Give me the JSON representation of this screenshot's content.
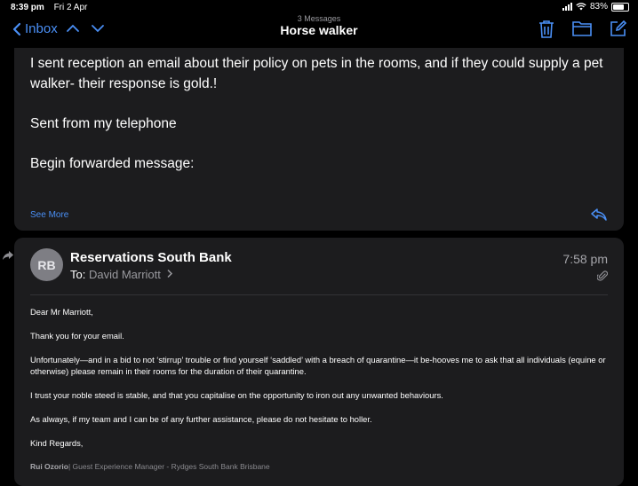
{
  "status": {
    "time": "8:39 pm",
    "date": "Fri 2 Apr",
    "battery": "83%",
    "battery_level": 0.83
  },
  "nav": {
    "back_label": "Inbox",
    "message_count": "3 Messages",
    "title": "Horse walker",
    "icons": [
      "chevron-left-icon",
      "chevron-up-icon",
      "chevron-down-icon",
      "trash-icon",
      "folder-icon",
      "compose-icon"
    ]
  },
  "message1": {
    "body_lines": [
      "I sent reception an email about their policy on pets in the rooms, and if they could supply a pet walker- their response is gold.!",
      "Sent from my telephone",
      "Begin forwarded message:"
    ],
    "see_more": "See More"
  },
  "message2": {
    "avatar_initials": "RB",
    "sender": "Reservations South Bank",
    "to_label": "To:",
    "to_name": "David Marriott",
    "time": "7:58 pm",
    "paragraphs": [
      "Dear Mr Marriott,",
      "Thank you for your email.",
      "Unfortunately—and in a bid to not ‘stirrup’ trouble or find yourself ‘saddled’ with a breach of quarantine—it be-hooves me to ask that all individuals (equine or otherwise) please remain in their rooms for the duration of their quarantine.",
      "I trust your noble steed is stable, and that you capitalise on the opportunity to iron out any unwanted behaviours.",
      "As always, if my team and I can be of any further assistance, please do not hesitate to holler.",
      "Kind Regards,"
    ],
    "signature_name": "Rui Ozorio",
    "signature_title": "| Guest Experience Manager - Rydges South Bank Brisbane"
  },
  "colors": {
    "accent": "#4a8ff5",
    "card": "#1c1c1e",
    "background": "#000000"
  }
}
